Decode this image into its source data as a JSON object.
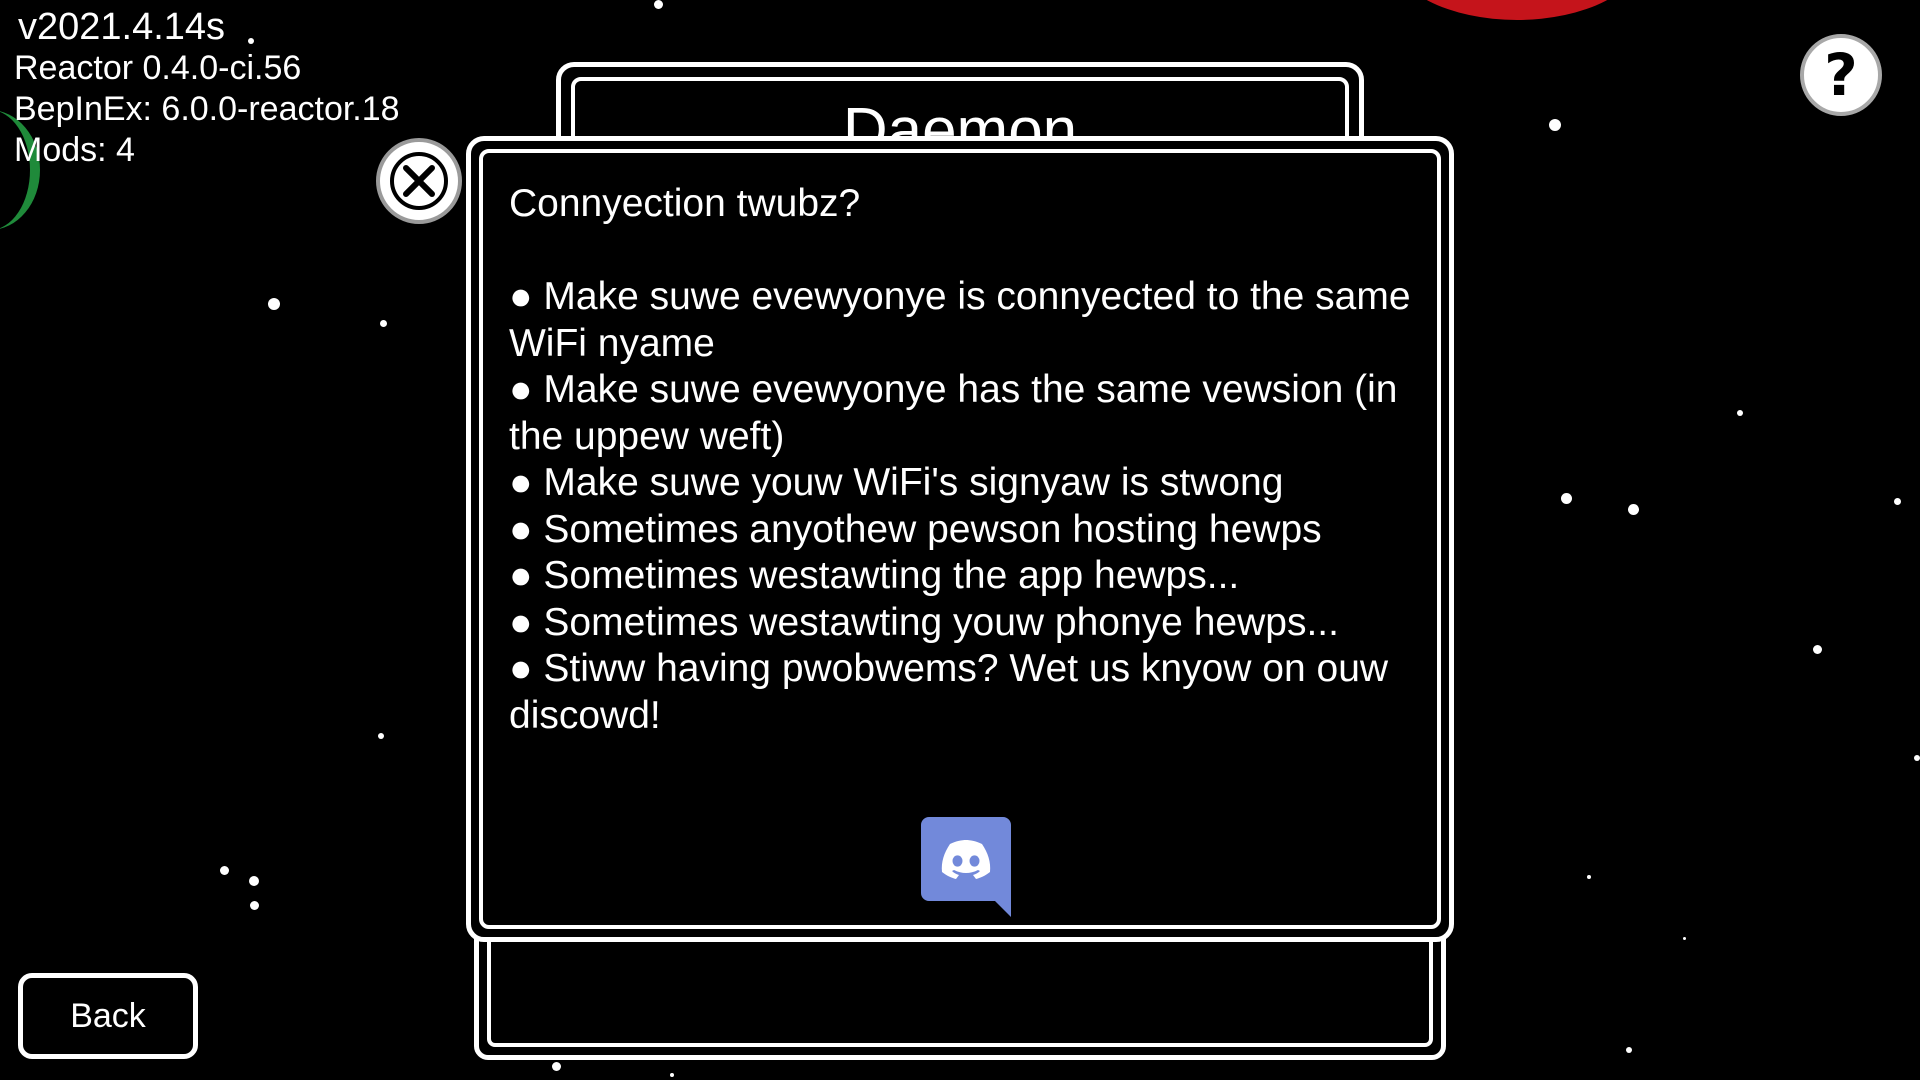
{
  "version_info": {
    "game_version": "v2021.4.14s",
    "reactor": "Reactor 0.4.0-ci.56",
    "bepinex": "BepInEx: 6.0.0-reactor.18",
    "mods": "Mods: 4"
  },
  "title_panel": {
    "title": "Daemon"
  },
  "popup": {
    "heading": "Connyection twubz?",
    "items": [
      "● Make suwe evewyonye is connyected to the same WiFi nyame",
      "● Make suwe evewyonye has the same vewsion (in the uppew weft)",
      "● Make suwe youw WiFi's signyaw is stwong",
      "● Sometimes anyothew pewson hosting hewps",
      "● Sometimes westawting the app hewps...",
      "● Sometimes westawting youw phonye hewps...",
      "● Stiww having pwobwems? Wet us knyow on ouw discowd!"
    ]
  },
  "buttons": {
    "back_label": "Back",
    "help_glyph": "?"
  },
  "icons": {
    "close": "close-icon",
    "help": "question-mark-icon",
    "discord": "discord-icon"
  },
  "colors": {
    "background": "#000000",
    "foreground": "#ffffff",
    "discord": "#7289da",
    "planet_red": "#c5141b"
  }
}
